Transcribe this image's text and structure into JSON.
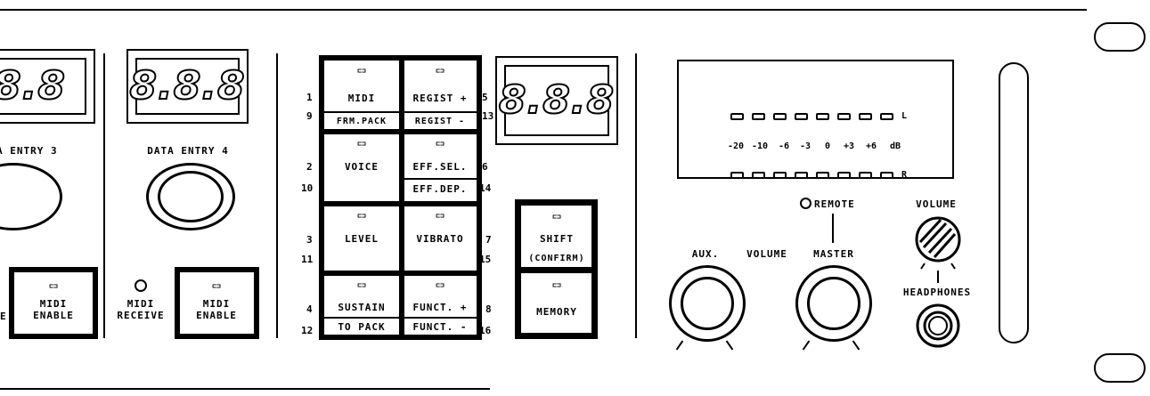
{
  "data_entry_3": {
    "display": "8.8",
    "label": "A ENTRY 3"
  },
  "data_entry_4": {
    "display": "8.8.8",
    "label": "DATA ENTRY 4"
  },
  "left_unit": {
    "side_label": "E",
    "enable_top": "MIDI",
    "enable_bottom": "ENABLE"
  },
  "midi_receive": {
    "top": "MIDI",
    "bottom": "RECEIVE"
  },
  "midi_enable": {
    "top": "MIDI",
    "bottom": "ENABLE"
  },
  "buttons": {
    "midi": {
      "top": "MIDI",
      "bottom": "FRM.PACK",
      "n1": "1",
      "n2": "9"
    },
    "regist": {
      "top": "REGIST +",
      "bottom": "REGIST -",
      "n1": "5",
      "n2": "13"
    },
    "voice": {
      "top": "VOICE",
      "n1": "2",
      "n2": "10"
    },
    "eff": {
      "top": "EFF.SEL.",
      "bottom": "EFF.DEP.",
      "n1": "6",
      "n2": "14"
    },
    "level": {
      "top": "LEVEL",
      "n1": "3",
      "n2": "11"
    },
    "vibrato": {
      "top": "VIBRATO",
      "n1": "7",
      "n2": "15"
    },
    "sustain": {
      "top": "SUSTAIN",
      "bottom": "TO PACK",
      "n1": "4",
      "n2": "12"
    },
    "funct": {
      "top": "FUNCT. +",
      "bottom": "FUNCT. -",
      "n1": "8",
      "n2": "16"
    },
    "shift": {
      "top": "SHIFT",
      "bottom": "(CONFIRM)"
    },
    "memory": {
      "top": "MEMORY"
    }
  },
  "main_display": "8.8.8",
  "meter": {
    "scale": [
      "-20",
      "-10",
      "-6",
      "-3",
      "0",
      "+3",
      "+6",
      "dB"
    ],
    "left": "L",
    "right": "R"
  },
  "remote": "REMOTE",
  "volume": "VOLUME",
  "aux": "AUX.",
  "aux_volume": "VOLUME",
  "master": "MASTER",
  "headphones": "HEADPHONES"
}
